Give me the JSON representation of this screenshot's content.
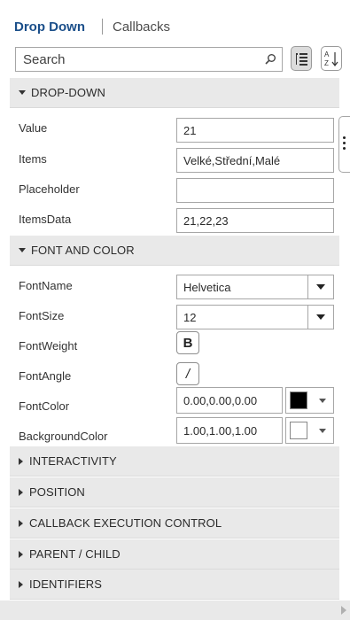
{
  "tabs": {
    "active": "Drop Down",
    "other": "Callbacks"
  },
  "search": {
    "placeholder": "Search"
  },
  "sections": {
    "dropdown": "DROP-DOWN",
    "font_color": "FONT AND COLOR",
    "interactivity": "INTERACTIVITY",
    "position": "POSITION",
    "callback": "CALLBACK EXECUTION CONTROL",
    "parent_child": "PARENT / CHILD",
    "identifiers": "IDENTIFIERS"
  },
  "dropdown_props": {
    "value_label": "Value",
    "value": "21",
    "items_label": "Items",
    "items": "Velké,Střední,Malé",
    "placeholder_label": "Placeholder",
    "placeholder": "",
    "itemsdata_label": "ItemsData",
    "itemsdata": "21,22,23"
  },
  "font_props": {
    "fontname_label": "FontName",
    "fontname": "Helvetica",
    "fontsize_label": "FontSize",
    "fontsize": "12",
    "fontweight_label": "FontWeight",
    "fontweight_glyph": "B",
    "fontangle_label": "FontAngle",
    "fontangle_glyph": "/",
    "fontcolor_label": "FontColor",
    "fontcolor": "0.00,0.00,0.00",
    "bgcolor_label": "BackgroundColor",
    "bgcolor": "1.00,1.00,1.00"
  },
  "colors": {
    "font_swatch": "#000000",
    "bg_swatch": "#ffffff",
    "tab_accent": "#1b4f8a"
  }
}
